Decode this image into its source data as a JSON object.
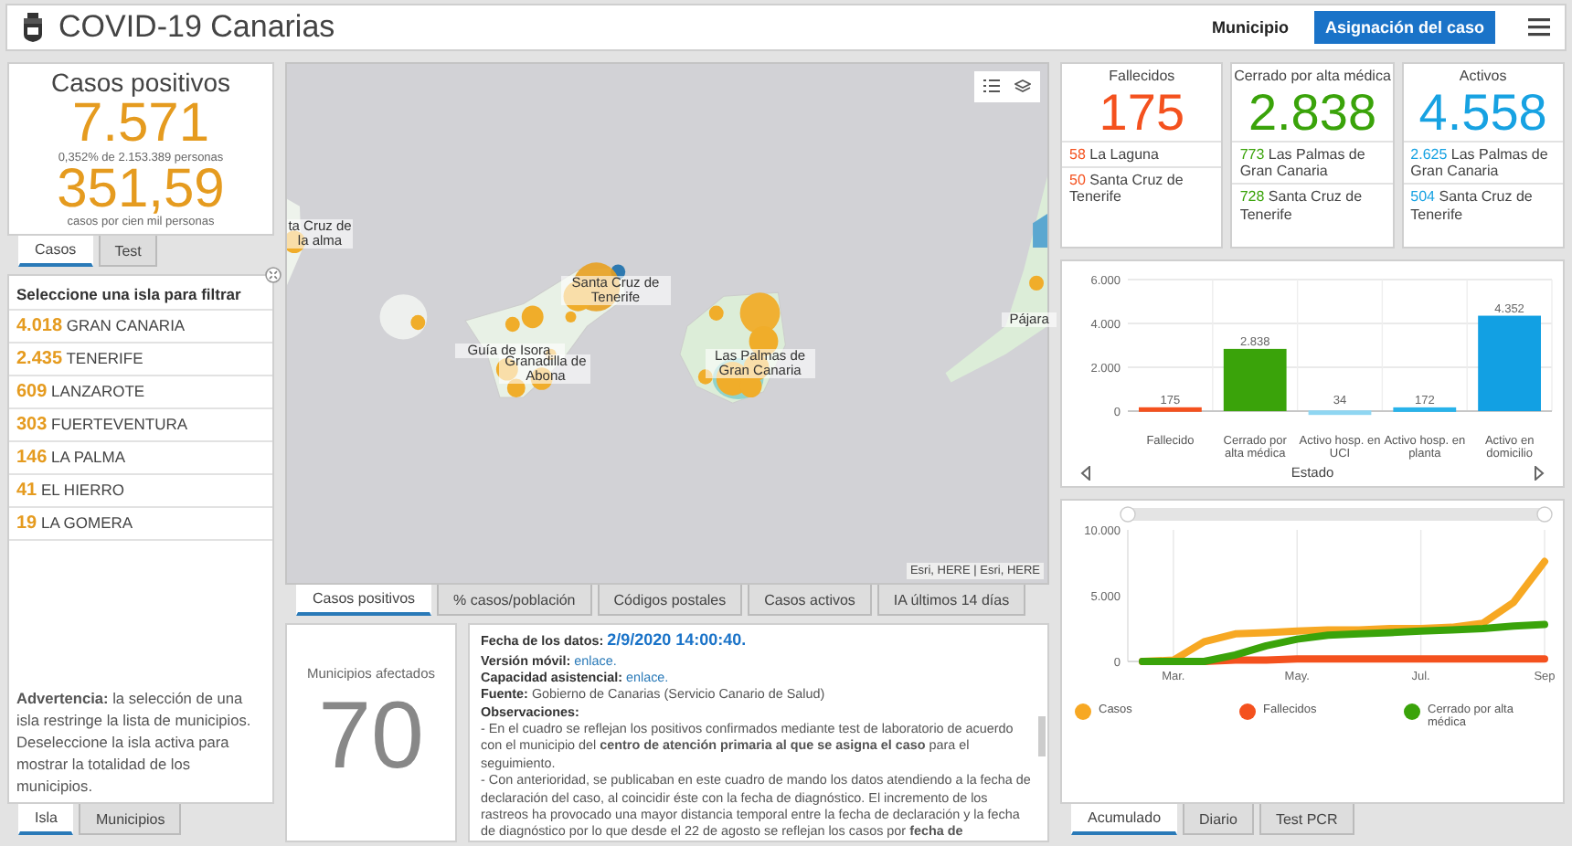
{
  "header": {
    "title": "COVID-19 Canarias",
    "tabs": [
      {
        "label": "Municipio",
        "selected": false
      },
      {
        "label": "Asignación del caso",
        "selected": true
      }
    ]
  },
  "cases_card": {
    "title": "Casos positivos",
    "value": "7.571",
    "share": "0,352% de 2.153.389 personas",
    "rate": "351,59",
    "rate_label": "casos por cien mil personas",
    "tabs": [
      {
        "label": "Casos",
        "selected": true
      },
      {
        "label": "Test",
        "selected": false
      }
    ]
  },
  "island_panel": {
    "title": "Seleccione una isla para filtrar",
    "islands": [
      {
        "count": "4.018",
        "name": "GRAN CANARIA"
      },
      {
        "count": "2.435",
        "name": "TENERIFE"
      },
      {
        "count": "609",
        "name": "LANZAROTE"
      },
      {
        "count": "303",
        "name": "FUERTEVENTURA"
      },
      {
        "count": "146",
        "name": "LA PALMA"
      },
      {
        "count": "41",
        "name": "EL HIERRO"
      },
      {
        "count": "19",
        "name": "LA GOMERA"
      }
    ],
    "warning": "**Advertencia:** la selección de una isla restringe la lista de municipios. Deseleccione la isla activa para mostrar la totalidad de los municipios.",
    "tabs": [
      {
        "label": "Isla",
        "selected": true
      },
      {
        "label": "Municipios",
        "selected": false
      }
    ]
  },
  "map": {
    "labels": [
      "ta Cruz de la alma",
      "Santa Cruz de Tenerife",
      "Guía de Isora",
      "Granadilla de Abona",
      "Las Palmas de Gran Canaria",
      "Pájara"
    ],
    "attribution": "Esri, HERE | Esri, HERE",
    "tabs": [
      {
        "label": "Casos positivos",
        "selected": true
      },
      {
        "label": "% casos/población",
        "selected": false
      },
      {
        "label": "Códigos postales",
        "selected": false
      },
      {
        "label": "Casos activos",
        "selected": false
      },
      {
        "label": "IA últimos 14 días",
        "selected": false
      }
    ]
  },
  "municipalities_card": {
    "title": "Municipios afectados",
    "value": "70"
  },
  "info": {
    "lines": [
      {
        "kind": "date",
        "label": "Fecha de los datos:",
        "value": "2/9/2020 14:00:40."
      },
      {
        "kind": "link",
        "label": "Versión móvil:",
        "link": "enlace."
      },
      {
        "kind": "link",
        "label": "Capacidad asistencial:",
        "link": "enlace."
      },
      {
        "kind": "field",
        "label": "Fuente:",
        "value": "Gobierno de Canarias (Servicio Canario de Salud)"
      },
      {
        "kind": "heading",
        "label": "Observaciones:"
      },
      {
        "kind": "para",
        "text": "- En el cuadro se reflejan los positivos confirmados mediante test de laboratorio de acuerdo con el municipio del **centro de atención primaria al que se asigna el caso** para el seguimiento."
      },
      {
        "kind": "para",
        "text": "- Con anterioridad, se publicaban en este cuadro de mando los datos atendiendo a la fecha de declaración del caso, al coincidir éste con la fecha de diagnóstico. El incremento de los rastreos ha provocado una mayor distancia temporal entre la fecha de declaración y la fecha de diagnóstico por lo que desde el 22 de agosto se reflejan los casos por **fecha de**"
      }
    ]
  },
  "summary_cards": [
    {
      "title": "Fallecidos",
      "value": "175",
      "color": "#f4511e",
      "items": [
        {
          "count": "58",
          "name": "La Laguna"
        },
        {
          "count": "50",
          "name": "Santa Cruz de Tenerife"
        }
      ]
    },
    {
      "title": "Cerrado por alta médica",
      "value": "2.838",
      "color": "#3aa30a",
      "items": [
        {
          "count": "773",
          "name": "Las Palmas de Gran Canaria"
        },
        {
          "count": "728",
          "name": "Santa Cruz de Tenerife"
        }
      ]
    },
    {
      "title": "Activos",
      "value": "4.558",
      "color": "#17a2e2",
      "items": [
        {
          "count": "2.625",
          "name": "Las Palmas de Gran Canaria"
        },
        {
          "count": "504",
          "name": "Santa Cruz de Tenerife"
        }
      ]
    }
  ],
  "status_chart": {
    "chart_data": {
      "type": "bar",
      "xlabel": "Estado",
      "categories": [
        "Fallecido",
        "Cerrado por alta médica",
        "Activo hosp. en UCI",
        "Activo hosp. en planta",
        "Activo en domicilio"
      ],
      "series": [
        {
          "values": [
            175,
            2838,
            34,
            172,
            4352
          ]
        }
      ],
      "colors": [
        "#f4511e",
        "#3aa30a",
        "#8fd6f2",
        "#29b3ea",
        "#12a0e3"
      ],
      "ylim": [
        0,
        6000
      ],
      "grid": true,
      "yticks": [
        {
          "value": 0,
          "label": "0"
        },
        {
          "value": 2000,
          "label": "2.000"
        },
        {
          "value": 4000,
          "label": "4.000"
        },
        {
          "value": 6000,
          "label": "6.000"
        }
      ],
      "value_labels": [
        "175",
        "2.838",
        "34",
        "172",
        "4.352"
      ]
    }
  },
  "evolution_chart": {
    "chart_data": {
      "type": "line",
      "categories": [
        null,
        "Mar.",
        null,
        null,
        null,
        "May.",
        null,
        null,
        null,
        "Jul.",
        null,
        null,
        null,
        "Sep"
      ],
      "series": [
        {
          "name": "Casos",
          "color": "#f7a823",
          "values": [
            0,
            100,
            1500,
            2100,
            2200,
            2300,
            2400,
            2400,
            2500,
            2500,
            2600,
            2900,
            4500,
            7600
          ]
        },
        {
          "name": "Fallecidos",
          "color": "#f4511e",
          "values": [
            0,
            0,
            0,
            100,
            100,
            200,
            200,
            200,
            200,
            200,
            200,
            200,
            200,
            200
          ]
        },
        {
          "name": "Cerrado por alta médica",
          "color": "#3aa30a",
          "values": [
            0,
            0,
            0,
            500,
            1200,
            1700,
            2000,
            2100,
            2200,
            2300,
            2400,
            2500,
            2700,
            2800
          ]
        }
      ],
      "ylim": [
        0,
        10000
      ],
      "grid": true,
      "legend": "bottom",
      "yticks": [
        {
          "value": 0,
          "label": "0"
        },
        {
          "value": 5000,
          "label": "5.000"
        },
        {
          "value": 10000,
          "label": "10.000"
        }
      ]
    },
    "tabs": [
      {
        "label": "Acumulado",
        "selected": true
      },
      {
        "label": "Diario",
        "selected": false
      },
      {
        "label": "Test PCR",
        "selected": false
      }
    ]
  }
}
